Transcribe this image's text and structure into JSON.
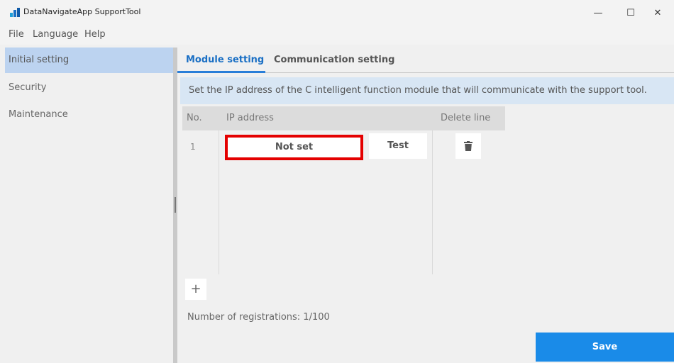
{
  "window": {
    "title": "DataNavigateApp SupportTool",
    "minimize": "—",
    "maximize": "☐",
    "close": "✕"
  },
  "menu": [
    "File",
    "Language",
    "Help"
  ],
  "sidebar": {
    "items": [
      {
        "label": "Initial setting",
        "active": true
      },
      {
        "label": "Security",
        "active": false
      },
      {
        "label": "Maintenance",
        "active": false
      }
    ]
  },
  "tabs": [
    {
      "label": "Module setting",
      "active": true
    },
    {
      "label": "Communication setting",
      "active": false
    }
  ],
  "info_text": "Set the IP address of the C intelligent function module that will communicate with the support tool.",
  "table": {
    "headers": {
      "no": "No.",
      "ip": "IP address",
      "delete": "Delete line"
    },
    "rows": [
      {
        "no": "1",
        "ip": "Not set",
        "test": "Test"
      }
    ]
  },
  "add_label": "+",
  "registrations": "Number of registrations: 1/100",
  "save_label": "Save",
  "colors": {
    "accent": "#1a8be8",
    "highlight": "#e40000",
    "sidebar_active": "#bcd3f0"
  },
  "icons": {
    "delete": "trash-icon",
    "app": "app-logo-icon"
  }
}
